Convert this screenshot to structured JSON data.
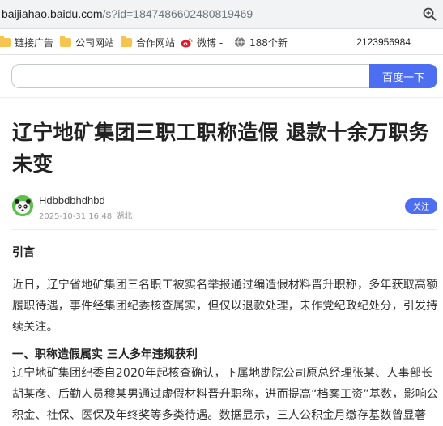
{
  "address_bar": {
    "host": "baijiahao.baidu.com",
    "path": "/s?id=1847486602480819469"
  },
  "bookmarks": [
    {
      "label": "链接广告",
      "icon": "folder-icon"
    },
    {
      "label": "公司网站",
      "icon": "folder-icon"
    },
    {
      "label": "合作网站",
      "icon": "folder-icon"
    },
    {
      "label": "微博 -",
      "icon": "weibo-icon"
    },
    {
      "label": "188个新",
      "icon": "globe-icon"
    }
  ],
  "bookmarks_right_text": "2123956984",
  "search": {
    "placeholder": "",
    "value": "",
    "button_label": "百度一下"
  },
  "article": {
    "title": "辽宁地矿集团三职工职称造假 退款十余万职务未变",
    "author": "Hdbbdbhdhbd",
    "date": "2025-10-31 16:48",
    "location": "湖北",
    "follow_label": "关注",
    "intro_heading": "引言",
    "intro_paragraph": "近日，辽宁省地矿集团三名职工被实名举报通过编造假材料晋升职称，多年获取高额履职待遇，事件经集团纪委核查属实，但仅以退款处理，未作党纪政纪处分，引发持续关注。",
    "section1_heading": "一、职称造假属实 三人多年违规获利",
    "section1_paragraph": "辽宁地矿集团纪委自2020年起核查确认，下属地勘院公司原总经理张某、人事部长胡某彦、后勤人员穆某男通过虚假材料晋升职称，进而提高“档案工资”基数，影响公积金、社保、医保及年终奖等多类待遇。数据显示，三人公积金月缴存基数曾显著"
  },
  "colors": {
    "accent": "#4e6ef2",
    "folder": "#f6c451",
    "avatar": "#55b94b"
  }
}
